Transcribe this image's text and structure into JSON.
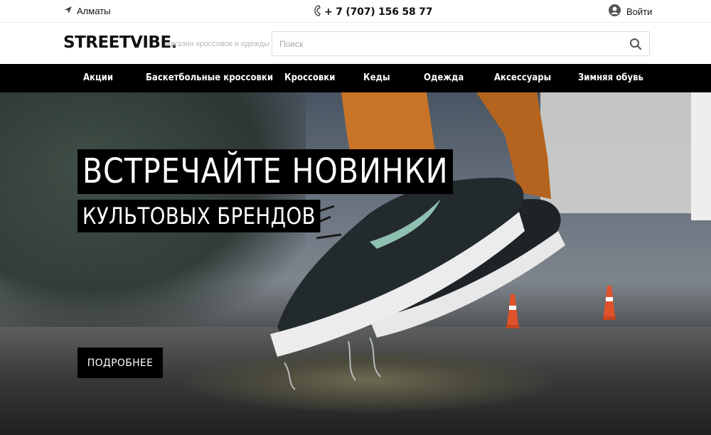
{
  "topbar": {
    "location": "Алматы",
    "location_icon": "location-arrow-icon",
    "phone": "+ 7 (707) 156 58 77",
    "phone_icon": "phone-icon",
    "login": "Войти",
    "login_icon": "user-icon"
  },
  "header": {
    "logo": "STREETVIBE.",
    "tagline": "магазин кроссовок и одежды",
    "search_placeholder": "Поиск",
    "search_icon": "search-icon"
  },
  "nav": {
    "items": [
      {
        "label": "Акции"
      },
      {
        "label": "Баскетбольные кроссовки"
      },
      {
        "label": "Кроссовки"
      },
      {
        "label": "Кеды"
      },
      {
        "label": "Одежда"
      },
      {
        "label": "Аксессуары"
      },
      {
        "label": "Зимняя обувь"
      }
    ]
  },
  "hero": {
    "headline_line1": "ВСТРЕЧАЙТЕ НОВИНКИ",
    "headline_line2": "КУЛЬТОВЫХ БРЕНДОВ",
    "button_label": "ПОДРОБНЕЕ"
  },
  "colors": {
    "nav_background": "#000000",
    "nav_text": "#ffffff",
    "tagline": "#b8b8b8"
  }
}
